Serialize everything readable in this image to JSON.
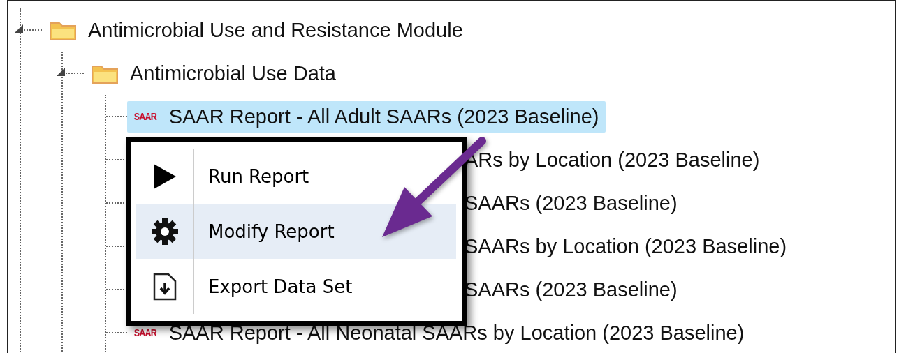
{
  "tree": [
    {
      "label": "Antimicrobial Use and Resistance Module",
      "kind": "folder",
      "expanded": true,
      "children": [
        {
          "label": "Antimicrobial Use Data",
          "kind": "folder",
          "expanded": true,
          "children": [
            {
              "label": "SAAR Report - All Adult SAARs (2023 Baseline)",
              "badge": "SAAR",
              "kind": "report",
              "selected": true
            },
            {
              "label": "ARs by Location (2023 Baseline)",
              "kind": "covered",
              "selected": false
            },
            {
              "label": "SAARs (2023 Baseline)",
              "kind": "covered",
              "selected": false
            },
            {
              "label": "SAARs by Location (2023 Baseline)",
              "kind": "covered",
              "selected": false
            },
            {
              "label": "SAARs (2023 Baseline)",
              "kind": "covered",
              "selected": false
            },
            {
              "label": "SAAR Report - All Neonatal SAARs by Location (2023 Baseline)",
              "badge": "SAAR",
              "kind": "report",
              "selected": false
            }
          ]
        }
      ]
    }
  ],
  "context_menu": {
    "items": [
      {
        "label": "Run Report",
        "kind": "play",
        "selected": false
      },
      {
        "label": "Modify Report",
        "kind": "gear",
        "selected": true
      },
      {
        "label": "Export Data Set",
        "kind": "export",
        "selected": false
      }
    ]
  }
}
